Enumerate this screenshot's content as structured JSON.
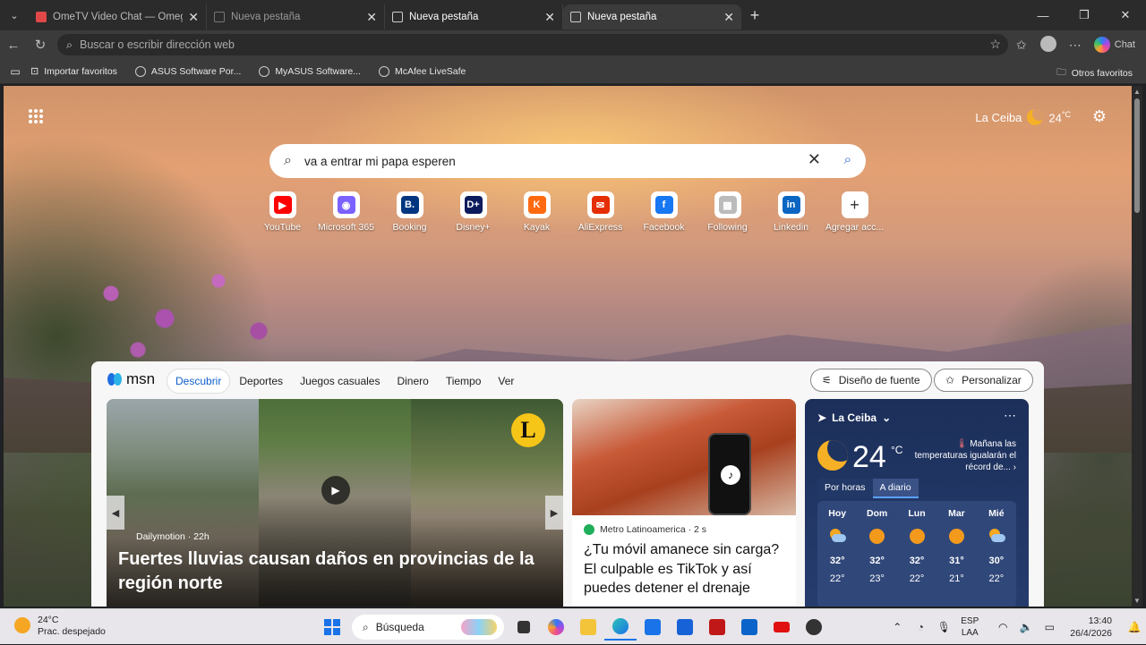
{
  "tabs": [
    {
      "label": "OmeTV Video Chat — Omegl",
      "active": false,
      "favicon_color": "#e04848"
    },
    {
      "label": "Nueva pestaña",
      "active": false,
      "favicon_color": "#666666"
    },
    {
      "label": "Nueva pestaña",
      "active": false,
      "favicon_color": "#cccccc"
    },
    {
      "label": "Nueva pestaña",
      "active": true,
      "favicon_color": "#cccccc"
    }
  ],
  "address": {
    "placeholder": "Buscar o escribir dirección web"
  },
  "toolbar": {
    "chat_label": "Chat"
  },
  "favorites": {
    "items": [
      "Importar favoritos",
      "ASUS Software Por...",
      "MyASUS Software...",
      "McAfee LiveSafe"
    ],
    "folder": "Otros favoritos"
  },
  "newtab": {
    "weather": {
      "city": "La Ceiba",
      "temp": "24",
      "unit": "°C"
    },
    "search_value": "va a entrar mi papa esperen",
    "quick_links": [
      {
        "label": "YouTube",
        "color": "#ff0000",
        "glyph": "▶"
      },
      {
        "label": "Microsoft 365",
        "color": "#7b61ff",
        "glyph": "◉"
      },
      {
        "label": "Booking",
        "color": "#003580",
        "glyph": "B."
      },
      {
        "label": "Disney+",
        "color": "#0b1b5c",
        "glyph": "D+"
      },
      {
        "label": "Kayak",
        "color": "#ff690f",
        "glyph": "K"
      },
      {
        "label": "AliExpress",
        "color": "#e62e04",
        "glyph": "✉"
      },
      {
        "label": "Facebook",
        "color": "#1877f2",
        "glyph": "f"
      },
      {
        "label": "Following",
        "color": "#bbbbbb",
        "glyph": "▦"
      },
      {
        "label": "Linkedin",
        "color": "#0a66c2",
        "glyph": "in"
      },
      {
        "label": "Agregar acc...",
        "color": "#ffffff",
        "glyph": "+"
      }
    ]
  },
  "msn": {
    "logo": "msn",
    "nav": [
      "Descubrir",
      "Deportes",
      "Juegos casuales",
      "Dinero",
      "Tiempo",
      "Ver"
    ],
    "font_button": "Diseño de fuente",
    "personalize_button": "Personalizar",
    "card1": {
      "source": "Dailymotion · 22h",
      "headline": "Fuertes lluvias causan daños en provincias de la región norte",
      "badge": "L"
    },
    "card2": {
      "source": "Metro Latinoamerica · 2 s",
      "headline": "¿Tu móvil amanece sin carga? El culpable es TikTok y así puedes detener el drenaje"
    },
    "weather_card": {
      "location": "La Ceiba",
      "temp": "24",
      "unit": "°C",
      "alert": "Mañana las temperaturas igualarán el récord de...",
      "toggle": [
        "Por horas",
        "A diario"
      ],
      "days": [
        {
          "day": "Hoy",
          "icon": "partly-cloudy",
          "hi": "32°",
          "lo": "22°"
        },
        {
          "day": "Dom",
          "icon": "sunny",
          "hi": "32°",
          "lo": "23°"
        },
        {
          "day": "Lun",
          "icon": "sunny",
          "hi": "32°",
          "lo": "22°"
        },
        {
          "day": "Mar",
          "icon": "sunny",
          "hi": "31°",
          "lo": "21°"
        },
        {
          "day": "Mié",
          "icon": "partly-cloudy",
          "hi": "30°",
          "lo": "22°"
        }
      ]
    }
  },
  "taskbar": {
    "weather_temp": "24°C",
    "weather_desc": "Prac. despejado",
    "search_label": "Búsqueda",
    "lang_line1": "ESP",
    "lang_line2": "LAA",
    "time": "13:40",
    "date": "26/4/2026"
  }
}
